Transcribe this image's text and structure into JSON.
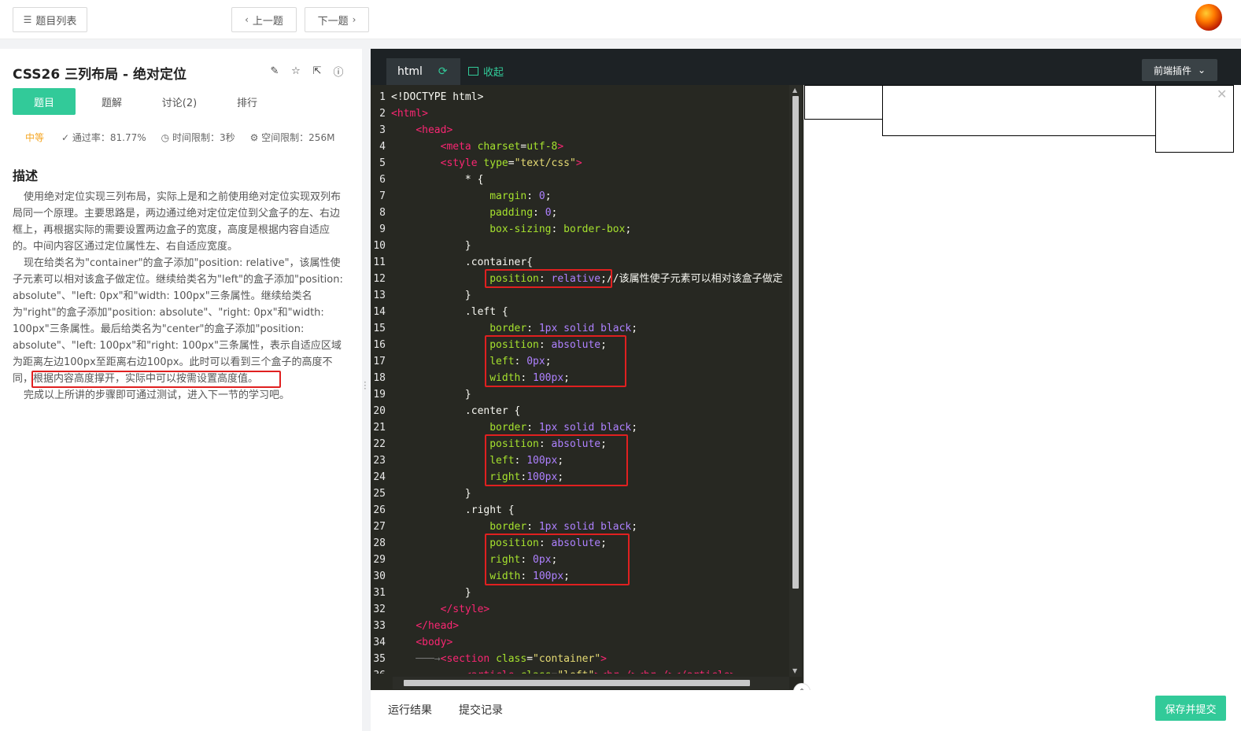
{
  "topbar": {
    "list_label": "题目列表",
    "prev_label": "上一题",
    "next_label": "下一题"
  },
  "problem": {
    "title": "CSS26  三列布局 - 绝对定位",
    "tabs": [
      "题目",
      "题解",
      "讨论(2)",
      "排行"
    ],
    "difficulty": "中等",
    "pass_rate": "通过率：81.77%",
    "time_limit": "时间限制：3秒",
    "space_limit": "空间限制：256M",
    "desc_heading": "描述",
    "desc_p1": "使用绝对定位实现三列布局，实际上是和之前使用绝对定位实现双列布局同一个原理。主要思路是，两边通过绝对定位定位到父盒子的左、右边框上，再根据实际的需要设置两边盒子的宽度，高度是根据内容自适应的。中间内容区通过定位属性左、右自适应宽度。",
    "desc_p2": "现在给类名为\"container\"的盒子添加\"position: relative\"，该属性使子元素可以相对该盒子做定位。继续给类名为\"left\"的盒子添加\"position: absolute\"、\"left: 0px\"和\"width: 100px\"三条属性。继续给类名为\"right\"的盒子添加\"position: absolute\"、\"right: 0px\"和\"width: 100px\"三条属性。最后给类名为\"center\"的盒子添加\"position: absolute\"、\"left: 100px\"和\"right: 100px\"三条属性，表示自适应区域为距离左边100px至距离右边100px。此时可以看到三个盒子的高度不同，根据内容高度撑开，实际中可以按需设置高度值。",
    "desc_p3": "完成以上所讲的步骤即可通过测试，进入下一节的学习吧。"
  },
  "editor": {
    "file_tab": "html",
    "collapse_label": "收起",
    "plugin_label": "前端插件",
    "code_lines": [
      [
        [
          "p",
          "<!DOCTYPE html>"
        ]
      ],
      [
        [
          "t",
          "<html>"
        ]
      ],
      [
        [
          "p",
          "    "
        ],
        [
          "t",
          "<head>"
        ]
      ],
      [
        [
          "p",
          "        "
        ],
        [
          "t",
          "<meta "
        ],
        [
          "a",
          "charset"
        ],
        [
          "p",
          "="
        ],
        [
          "a",
          "utf-8"
        ],
        [
          "t",
          ">"
        ]
      ],
      [
        [
          "p",
          "        "
        ],
        [
          "t",
          "<style "
        ],
        [
          "a",
          "type"
        ],
        [
          "p",
          "="
        ],
        [
          "s",
          "\"text/css\""
        ],
        [
          "t",
          ">"
        ]
      ],
      [
        [
          "p",
          "            * {"
        ]
      ],
      [
        [
          "p",
          "                "
        ],
        [
          "k",
          "margin"
        ],
        [
          "p",
          ": "
        ],
        [
          "v",
          "0"
        ],
        [
          "p",
          ";"
        ]
      ],
      [
        [
          "p",
          "                "
        ],
        [
          "k",
          "padding"
        ],
        [
          "p",
          ": "
        ],
        [
          "v",
          "0"
        ],
        [
          "p",
          ";"
        ]
      ],
      [
        [
          "p",
          "                "
        ],
        [
          "k",
          "box-sizing"
        ],
        [
          "p",
          ": "
        ],
        [
          "k",
          "border-box"
        ],
        [
          "p",
          ";"
        ]
      ],
      [
        [
          "p",
          "            }"
        ]
      ],
      [
        [
          "p",
          "            .container{"
        ]
      ],
      [
        [
          "p",
          "                "
        ],
        [
          "k",
          "position"
        ],
        [
          "p",
          ": "
        ],
        [
          "v",
          "relative"
        ],
        [
          "p",
          ";//该属性使子元素可以相对该盒子做定"
        ]
      ],
      [
        [
          "p",
          "            }"
        ]
      ],
      [
        [
          "p",
          "            .left {"
        ]
      ],
      [
        [
          "p",
          "                "
        ],
        [
          "k",
          "border"
        ],
        [
          "p",
          ": "
        ],
        [
          "v",
          "1px solid black"
        ],
        [
          "p",
          ";"
        ]
      ],
      [
        [
          "p",
          "                "
        ],
        [
          "k",
          "position"
        ],
        [
          "p",
          ": "
        ],
        [
          "v",
          "absolute"
        ],
        [
          "p",
          ";"
        ]
      ],
      [
        [
          "p",
          "                "
        ],
        [
          "k",
          "left"
        ],
        [
          "p",
          ": "
        ],
        [
          "v",
          "0px"
        ],
        [
          "p",
          ";"
        ]
      ],
      [
        [
          "p",
          "                "
        ],
        [
          "k",
          "width"
        ],
        [
          "p",
          ": "
        ],
        [
          "v",
          "100px"
        ],
        [
          "p",
          ";"
        ]
      ],
      [
        [
          "p",
          "            }"
        ]
      ],
      [
        [
          "p",
          "            .center {"
        ]
      ],
      [
        [
          "p",
          "                "
        ],
        [
          "k",
          "border"
        ],
        [
          "p",
          ": "
        ],
        [
          "v",
          "1px solid black"
        ],
        [
          "p",
          ";"
        ]
      ],
      [
        [
          "p",
          "                "
        ],
        [
          "k",
          "position"
        ],
        [
          "p",
          ": "
        ],
        [
          "v",
          "absolute"
        ],
        [
          "p",
          ";"
        ]
      ],
      [
        [
          "p",
          "                "
        ],
        [
          "k",
          "left"
        ],
        [
          "p",
          ": "
        ],
        [
          "v",
          "100px"
        ],
        [
          "p",
          ";"
        ]
      ],
      [
        [
          "p",
          "                "
        ],
        [
          "k",
          "right"
        ],
        [
          "p",
          ":"
        ],
        [
          "v",
          "100px"
        ],
        [
          "p",
          ";"
        ]
      ],
      [
        [
          "p",
          "            }"
        ]
      ],
      [
        [
          "p",
          "            .right {"
        ]
      ],
      [
        [
          "p",
          "                "
        ],
        [
          "k",
          "border"
        ],
        [
          "p",
          ": "
        ],
        [
          "v",
          "1px solid black"
        ],
        [
          "p",
          ";"
        ]
      ],
      [
        [
          "p",
          "                "
        ],
        [
          "k",
          "position"
        ],
        [
          "p",
          ": "
        ],
        [
          "v",
          "absolute"
        ],
        [
          "p",
          ";"
        ]
      ],
      [
        [
          "p",
          "                "
        ],
        [
          "k",
          "right"
        ],
        [
          "p",
          ": "
        ],
        [
          "v",
          "0px"
        ],
        [
          "p",
          ";"
        ]
      ],
      [
        [
          "p",
          "                "
        ],
        [
          "k",
          "width"
        ],
        [
          "p",
          ": "
        ],
        [
          "v",
          "100px"
        ],
        [
          "p",
          ";"
        ]
      ],
      [
        [
          "p",
          "            }"
        ]
      ],
      [
        [
          "p",
          "        "
        ],
        [
          "t",
          "</style>"
        ]
      ],
      [
        [
          "p",
          "    "
        ],
        [
          "t",
          "</head>"
        ]
      ],
      [
        [
          "p",
          "    "
        ],
        [
          "t",
          "<body>"
        ]
      ],
      [
        [
          "r",
          "    ───→"
        ],
        [
          "t",
          "<section "
        ],
        [
          "a",
          "class"
        ],
        [
          "p",
          "="
        ],
        [
          "s",
          "\"container\""
        ],
        [
          "t",
          ">"
        ]
      ],
      [
        [
          "p",
          "            "
        ],
        [
          "t",
          "<article "
        ],
        [
          "a",
          "class"
        ],
        [
          "p",
          "="
        ],
        [
          "s",
          "\"left\""
        ],
        [
          "t",
          "><br /><br /></article>"
        ]
      ],
      [
        [
          "p",
          ""
        ]
      ]
    ]
  },
  "bottom": {
    "run_result": "运行结果",
    "submit_record": "提交记录",
    "save_submit": "保存并提交"
  },
  "colors": {
    "accent": "#32ca99",
    "highlight_box": "#e02020",
    "editor_bg": "#272822"
  }
}
